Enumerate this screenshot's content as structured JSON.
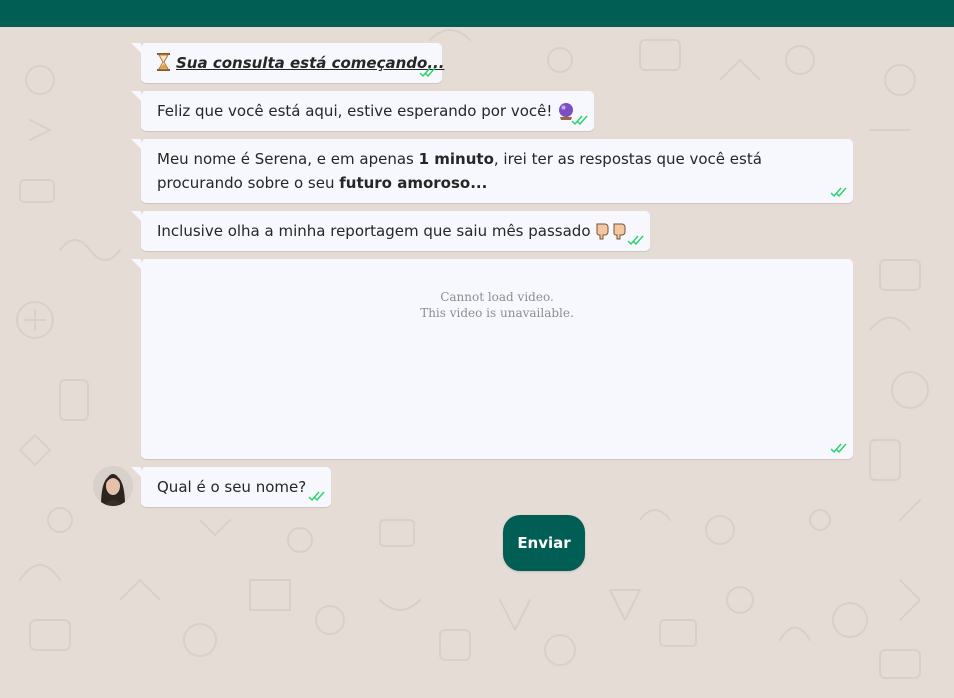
{
  "chat": {
    "messages": [
      {
        "type": "title",
        "text": "Sua consulta está começando..."
      },
      {
        "type": "text",
        "text": "Feliz que você está aqui, estive esperando por você!"
      },
      {
        "type": "rich",
        "parts": [
          "Meu nome é Serena, e em apenas ",
          "1 minuto",
          ", irei ter as respostas que você está procurando sobre o seu ",
          "futuro amoroso..."
        ]
      },
      {
        "type": "text",
        "text": "Inclusive olha a minha reportagem que saiu mês passado"
      },
      {
        "type": "video",
        "error_line1": "Cannot load video.",
        "error_line2": "This video is unavailable."
      },
      {
        "type": "text",
        "text": "Qual é o seu nome?"
      }
    ]
  },
  "actions": {
    "send_label": "Enviar"
  },
  "colors": {
    "header": "#005e54",
    "bubble": "#f7f8fd",
    "ticks": "#25d366",
    "background": "#e5ddd5"
  },
  "icons": [
    "hourglass-icon",
    "crystal-ball-icon",
    "pointing-down-icon",
    "read-receipt-icon"
  ]
}
